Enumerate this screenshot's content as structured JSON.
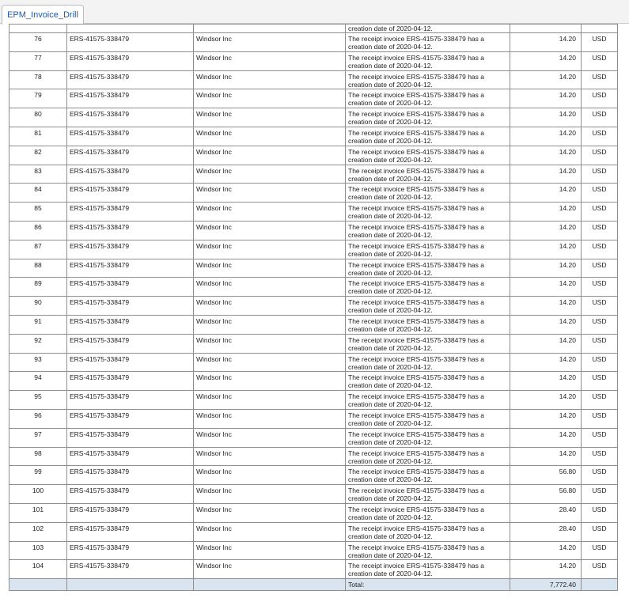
{
  "tabs": [
    {
      "label": "EPM_Invoice_Drill",
      "active": true
    }
  ],
  "table": {
    "partial_row": {
      "description": "creation date of 2020-04-12."
    },
    "rows": [
      {
        "num": "76",
        "invoice": "ERS-41575-338479",
        "supplier": "Windsor Inc",
        "desc1": "The receipt invoice ERS-41575-338479 has a",
        "desc2": "creation date of 2020-04-12.",
        "amount": "14.20",
        "currency": "USD"
      },
      {
        "num": "77",
        "invoice": "ERS-41575-338479",
        "supplier": "Windsor Inc",
        "desc1": "The receipt invoice ERS-41575-338479 has a",
        "desc2": "creation date of 2020-04-12.",
        "amount": "14.20",
        "currency": "USD"
      },
      {
        "num": "78",
        "invoice": "ERS-41575-338479",
        "supplier": "Windsor Inc",
        "desc1": "The receipt invoice ERS-41575-338479 has a",
        "desc2": "creation date of 2020-04-12.",
        "amount": "14.20",
        "currency": "USD"
      },
      {
        "num": "79",
        "invoice": "ERS-41575-338479",
        "supplier": "Windsor Inc",
        "desc1": "The receipt invoice ERS-41575-338479 has a",
        "desc2": "creation date of 2020-04-12.",
        "amount": "14.20",
        "currency": "USD"
      },
      {
        "num": "80",
        "invoice": "ERS-41575-338479",
        "supplier": "Windsor Inc",
        "desc1": "The receipt invoice ERS-41575-338479 has a",
        "desc2": "creation date of 2020-04-12.",
        "amount": "14.20",
        "currency": "USD"
      },
      {
        "num": "81",
        "invoice": "ERS-41575-338479",
        "supplier": "Windsor Inc",
        "desc1": "The receipt invoice ERS-41575-338479 has a",
        "desc2": "creation date of 2020-04-12.",
        "amount": "14.20",
        "currency": "USD"
      },
      {
        "num": "82",
        "invoice": "ERS-41575-338479",
        "supplier": "Windsor Inc",
        "desc1": "The receipt invoice ERS-41575-338479 has a",
        "desc2": "creation date of 2020-04-12.",
        "amount": "14.20",
        "currency": "USD"
      },
      {
        "num": "83",
        "invoice": "ERS-41575-338479",
        "supplier": "Windsor Inc",
        "desc1": "The receipt invoice ERS-41575-338479 has a",
        "desc2": "creation date of 2020-04-12.",
        "amount": "14.20",
        "currency": "USD"
      },
      {
        "num": "84",
        "invoice": "ERS-41575-338479",
        "supplier": "Windsor Inc",
        "desc1": "The receipt invoice ERS-41575-338479 has a",
        "desc2": "creation date of 2020-04-12.",
        "amount": "14.20",
        "currency": "USD"
      },
      {
        "num": "85",
        "invoice": "ERS-41575-338479",
        "supplier": "Windsor Inc",
        "desc1": "The receipt invoice ERS-41575-338479 has a",
        "desc2": "creation date of 2020-04-12.",
        "amount": "14.20",
        "currency": "USD"
      },
      {
        "num": "86",
        "invoice": "ERS-41575-338479",
        "supplier": "Windsor Inc",
        "desc1": "The receipt invoice ERS-41575-338479 has a",
        "desc2": "creation date of 2020-04-12.",
        "amount": "14.20",
        "currency": "USD"
      },
      {
        "num": "87",
        "invoice": "ERS-41575-338479",
        "supplier": "Windsor Inc",
        "desc1": "The receipt invoice ERS-41575-338479 has a",
        "desc2": "creation date of 2020-04-12.",
        "amount": "14.20",
        "currency": "USD"
      },
      {
        "num": "88",
        "invoice": "ERS-41575-338479",
        "supplier": "Windsor Inc",
        "desc1": "The receipt invoice ERS-41575-338479 has a",
        "desc2": "creation date of 2020-04-12.",
        "amount": "14.20",
        "currency": "USD"
      },
      {
        "num": "89",
        "invoice": "ERS-41575-338479",
        "supplier": "Windsor Inc",
        "desc1": "The receipt invoice ERS-41575-338479 has a",
        "desc2": "creation date of 2020-04-12.",
        "amount": "14.20",
        "currency": "USD"
      },
      {
        "num": "90",
        "invoice": "ERS-41575-338479",
        "supplier": "Windsor Inc",
        "desc1": "The receipt invoice ERS-41575-338479 has a",
        "desc2": "creation date of 2020-04-12.",
        "amount": "14.20",
        "currency": "USD"
      },
      {
        "num": "91",
        "invoice": "ERS-41575-338479",
        "supplier": "Windsor Inc",
        "desc1": "The receipt invoice ERS-41575-338479 has a",
        "desc2": "creation date of 2020-04-12.",
        "amount": "14.20",
        "currency": "USD"
      },
      {
        "num": "92",
        "invoice": "ERS-41575-338479",
        "supplier": "Windsor Inc",
        "desc1": "The receipt invoice ERS-41575-338479 has a",
        "desc2": "creation date of 2020-04-12.",
        "amount": "14.20",
        "currency": "USD"
      },
      {
        "num": "93",
        "invoice": "ERS-41575-338479",
        "supplier": "Windsor Inc",
        "desc1": "The receipt invoice ERS-41575-338479 has a",
        "desc2": "creation date of 2020-04-12.",
        "amount": "14.20",
        "currency": "USD"
      },
      {
        "num": "94",
        "invoice": "ERS-41575-338479",
        "supplier": "Windsor Inc",
        "desc1": "The receipt invoice ERS-41575-338479 has a",
        "desc2": "creation date of 2020-04-12.",
        "amount": "14.20",
        "currency": "USD"
      },
      {
        "num": "95",
        "invoice": "ERS-41575-338479",
        "supplier": "Windsor Inc",
        "desc1": "The receipt invoice ERS-41575-338479 has a",
        "desc2": "creation date of 2020-04-12.",
        "amount": "14.20",
        "currency": "USD"
      },
      {
        "num": "96",
        "invoice": "ERS-41575-338479",
        "supplier": "Windsor Inc",
        "desc1": "The receipt invoice ERS-41575-338479 has a",
        "desc2": "creation date of 2020-04-12.",
        "amount": "14.20",
        "currency": "USD"
      },
      {
        "num": "97",
        "invoice": "ERS-41575-338479",
        "supplier": "Windsor Inc",
        "desc1": "The receipt invoice ERS-41575-338479 has a",
        "desc2": "creation date of 2020-04-12.",
        "amount": "14.20",
        "currency": "USD"
      },
      {
        "num": "98",
        "invoice": "ERS-41575-338479",
        "supplier": "Windsor Inc",
        "desc1": "The receipt invoice ERS-41575-338479 has a",
        "desc2": "creation date of 2020-04-12.",
        "amount": "14.20",
        "currency": "USD"
      },
      {
        "num": "99",
        "invoice": "ERS-41575-338479",
        "supplier": "Windsor Inc",
        "desc1": "The receipt invoice ERS-41575-338479 has a",
        "desc2": "creation date of 2020-04-12.",
        "amount": "56.80",
        "currency": "USD"
      },
      {
        "num": "100",
        "invoice": "ERS-41575-338479",
        "supplier": "Windsor Inc",
        "desc1": "The receipt invoice ERS-41575-338479 has a",
        "desc2": "creation date of 2020-04-12.",
        "amount": "56.80",
        "currency": "USD"
      },
      {
        "num": "101",
        "invoice": "ERS-41575-338479",
        "supplier": "Windsor Inc",
        "desc1": "The receipt invoice ERS-41575-338479 has a",
        "desc2": "creation date of 2020-04-12.",
        "amount": "28.40",
        "currency": "USD"
      },
      {
        "num": "102",
        "invoice": "ERS-41575-338479",
        "supplier": "Windsor Inc",
        "desc1": "The receipt invoice ERS-41575-338479 has a",
        "desc2": "creation date of 2020-04-12.",
        "amount": "28.40",
        "currency": "USD"
      },
      {
        "num": "103",
        "invoice": "ERS-41575-338479",
        "supplier": "Windsor Inc",
        "desc1": "The receipt invoice ERS-41575-338479 has a",
        "desc2": "creation date of 2020-04-12.",
        "amount": "14.20",
        "currency": "USD"
      },
      {
        "num": "104",
        "invoice": "ERS-41575-338479",
        "supplier": "Windsor Inc",
        "desc1": "The receipt invoice ERS-41575-338479 has a",
        "desc2": "creation date of 2020-04-12.",
        "amount": "14.20",
        "currency": "USD"
      }
    ],
    "total": {
      "label": "Total:",
      "amount": "7,772.40"
    }
  },
  "colors": {
    "accent": "#1e5aa8",
    "total_row_bg": "#d8e4f0",
    "grid_line": "#8e8e8e"
  }
}
